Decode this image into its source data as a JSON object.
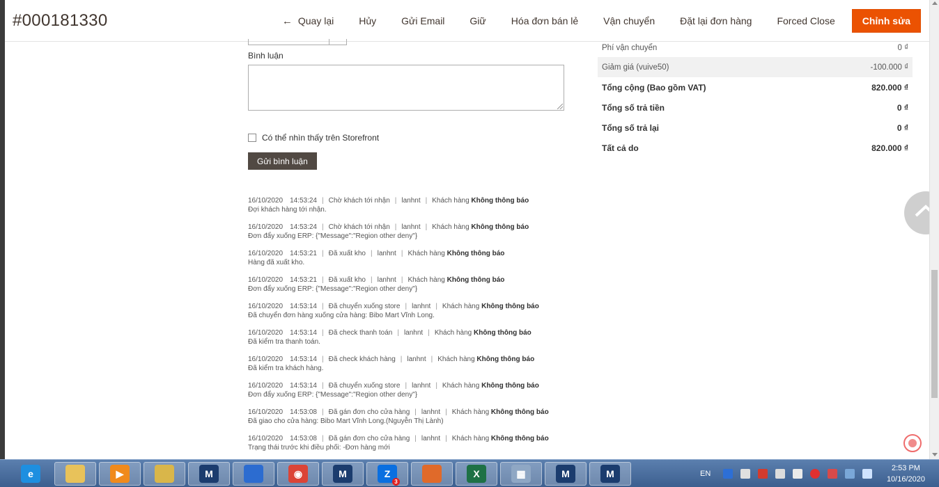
{
  "header": {
    "order_id": "#000181330",
    "buttons": {
      "back": "Quay lại",
      "cancel": "Hủy",
      "send_email": "Gửi Email",
      "hold": "Giữ",
      "retail_invoice": "Hóa đơn bán lẻ",
      "shipping": "Vận chuyển",
      "reorder": "Đặt lại đơn hàng",
      "forced_close": "Forced Close",
      "edit": "Chỉnh sửa"
    }
  },
  "comment_form": {
    "label": "Bình luận",
    "textarea_value": "",
    "visible_on_storefront_label": "Có thể nhìn thấy trên Storefront",
    "visible_on_storefront_checked": false,
    "submit_label": "Gửi bình luận"
  },
  "history": [
    {
      "date": "16/10/2020",
      "time": "14:53:24",
      "status": "Chờ khách tới nhận",
      "user": "lanhnt",
      "customer_label": "Khách hàng",
      "notify": "Không thông báo",
      "note": "Đợi khách hàng tới nhận."
    },
    {
      "date": "16/10/2020",
      "time": "14:53:24",
      "status": "Chờ khách tới nhận",
      "user": "lanhnt",
      "customer_label": "Khách hàng",
      "notify": "Không thông báo",
      "note": "Đơn đẩy xuống ERP: {\"Message\":\"Region other deny\"}"
    },
    {
      "date": "16/10/2020",
      "time": "14:53:21",
      "status": "Đã xuất kho",
      "user": "lanhnt",
      "customer_label": "Khách hàng",
      "notify": "Không thông báo",
      "note": "Hàng đã xuất kho."
    },
    {
      "date": "16/10/2020",
      "time": "14:53:21",
      "status": "Đã xuất kho",
      "user": "lanhnt",
      "customer_label": "Khách hàng",
      "notify": "Không thông báo",
      "note": "Đơn đẩy xuống ERP: {\"Message\":\"Region other deny\"}"
    },
    {
      "date": "16/10/2020",
      "time": "14:53:14",
      "status": "Đã chuyển xuống store",
      "user": "lanhnt",
      "customer_label": "Khách hàng",
      "notify": "Không thông báo",
      "note": "Đã chuyển đơn hàng xuống cửa hàng: Bibo Mart Vĩnh Long."
    },
    {
      "date": "16/10/2020",
      "time": "14:53:14",
      "status": "Đã check thanh toán",
      "user": "lanhnt",
      "customer_label": "Khách hàng",
      "notify": "Không thông báo",
      "note": "Đã kiểm tra thanh toán."
    },
    {
      "date": "16/10/2020",
      "time": "14:53:14",
      "status": "Đã check khách hàng",
      "user": "lanhnt",
      "customer_label": "Khách hàng",
      "notify": "Không thông báo",
      "note": "Đã kiểm tra khách hàng."
    },
    {
      "date": "16/10/2020",
      "time": "14:53:14",
      "status": "Đã chuyển xuống store",
      "user": "lanhnt",
      "customer_label": "Khách hàng",
      "notify": "Không thông báo",
      "note": "Đơn đẩy xuống ERP: {\"Message\":\"Region other deny\"}"
    },
    {
      "date": "16/10/2020",
      "time": "14:53:08",
      "status": "Đã gán đơn cho cửa hàng",
      "user": "lanhnt",
      "customer_label": "Khách hàng",
      "notify": "Không thông báo",
      "note": "Đã giao cho cửa hàng: Bibo Mart Vĩnh Long.(Nguyễn Thị Lành)"
    },
    {
      "date": "16/10/2020",
      "time": "14:53:08",
      "status": "Đã gán đơn cho cửa hàng",
      "user": "lanhnt",
      "customer_label": "Khách hàng",
      "notify": "Không thông báo",
      "note": "Trạng thái trước khi điều phối: -Đơn hàng mới"
    }
  ],
  "totals": {
    "shipping_label": "Phí vận chuyển",
    "shipping_value": "0 ₫",
    "discount_label": "Giảm giá (vuive50)",
    "discount_value": "-100.000 ₫",
    "grand_total_label": "Tổng cộng (Bao gồm VAT)",
    "grand_total_value": "820.000 ₫",
    "paid_label": "Tổng số trả tiền",
    "paid_value": "0 ₫",
    "refunded_label": "Tổng số trả lại",
    "refunded_value": "0 ₫",
    "due_label": "Tất cả do",
    "due_value": "820.000 ₫"
  },
  "taskbar": {
    "icons": [
      "ie-icon",
      "explorer-icon",
      "media-player-icon",
      "folder-icon",
      "app-m-icon",
      "wifi-app-icon",
      "chrome-icon",
      "app-m-icon",
      "zalo-icon",
      "paint-icon",
      "excel-icon",
      "calculator-icon",
      "app-m-icon",
      "app-m-icon"
    ],
    "zalo_badge": "3",
    "language": "EN",
    "time": "2:53 PM",
    "date": "10/16/2020"
  },
  "colors": {
    "primary_button": "#eb5202",
    "dark_button": "#514943",
    "taskbar": "#4a6f9f"
  }
}
